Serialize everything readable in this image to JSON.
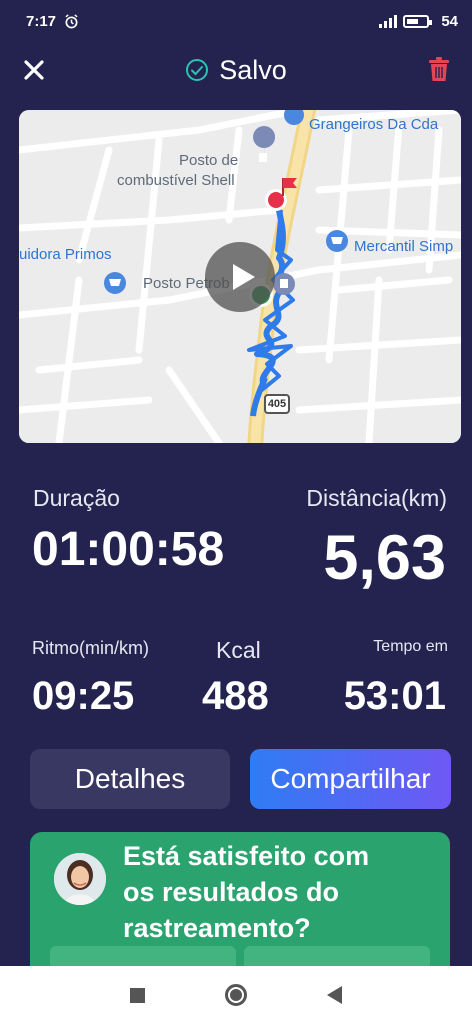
{
  "status": {
    "time": "7:17",
    "battery": "54"
  },
  "header": {
    "title": "Salvo"
  },
  "map": {
    "labels": {
      "gas1_line1": "Posto de",
      "gas1_line2": "combustível Shell",
      "store_top": "Grangeiros Da Cda",
      "store_left": "uidora Primos",
      "store_right": "Mercantil Simp",
      "gas2": "Posto Petrob",
      "road": "405"
    }
  },
  "stats": {
    "duration_label": "Duração",
    "duration_value": "01:00:58",
    "distance_label": "Distância(km)",
    "distance_value": "5,63",
    "pace_label": "Ritmo(min/km)",
    "pace_value": "09:25",
    "kcal_label": "Kcal",
    "kcal_value": "488",
    "moving_label": "Tempo em",
    "moving_value": "53:01"
  },
  "actions": {
    "details": "Detalhes",
    "share": "Compartilhar"
  },
  "survey": {
    "line1": "Está satisfeito com",
    "line2": "os resultados do",
    "line3": "rastreamento?"
  },
  "colors": {
    "background": "#24234f",
    "accent_green": "#2aa36f",
    "route_blue": "#2f7bea",
    "trash_red": "#e3445a"
  }
}
